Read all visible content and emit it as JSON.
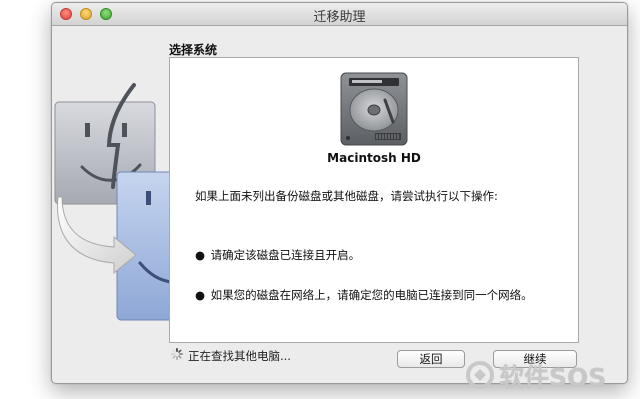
{
  "window": {
    "title": "迁移助理",
    "heading": "选择系统"
  },
  "disk": {
    "name": "Macintosh HD",
    "icon": "hard-drive-icon"
  },
  "instructions": {
    "intro": "如果上面未列出备份磁盘或其他磁盘，请尝试执行以下操作:",
    "bullets": [
      "请确定该磁盘已连接且开启。",
      "如果您的磁盘在网络上，请确定您的电脑已连接到同一个网络。"
    ],
    "bullet_symbol": "●"
  },
  "status": {
    "text": "正在查找其他电脑..."
  },
  "buttons": {
    "back": "返回",
    "continue": "继续"
  },
  "watermark": {
    "text": "软件SOS"
  },
  "colors": {
    "finder_back": "#b8bcc4",
    "finder_front": "#9fb6de",
    "window_bg": "#ececec"
  }
}
